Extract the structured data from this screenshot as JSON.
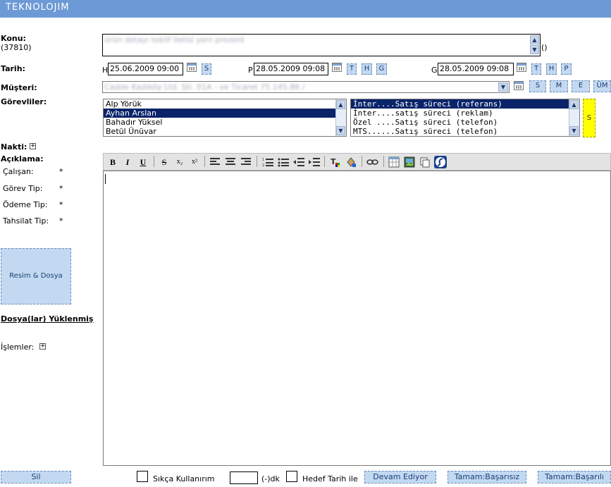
{
  "header": {
    "brand": "TEKNOLOJIM"
  },
  "form": {
    "konu_label": "Konu:",
    "konu_id": "(37810)",
    "konu_value": "ürün detayı teklif iletisi yeni prezent",
    "konu_suffix": "()",
    "tarih_label": "Tarih:",
    "h_prefix": "H",
    "h_date": "25.06.2009 09:00",
    "h_buttons": [
      "S"
    ],
    "p_prefix": "P",
    "p_date": "28.05.2009 09:08",
    "p_buttons": [
      "T",
      "H",
      "G"
    ],
    "g_prefix": "G",
    "g_date": "28.05.2009 09:08",
    "g_buttons": [
      "T",
      "H",
      "P"
    ],
    "musteri_label": "Müşteri:",
    "musteri_value": "Cadde Kadıköy Ltd. Şti. 01A - ve Ticaret 75.145.86 /",
    "musteri_buttons": [
      "S",
      "M",
      "E",
      "ÜM"
    ],
    "gorevliler_label": "Görevliler:",
    "people": [
      "Alp Yörük",
      "Ayhan Arslan",
      "Bahadır Yüksel",
      "Betül Ünüvar"
    ],
    "tasks": [
      "İnter....Satış süreci (referans)",
      "İnter....satış süreci (reklam)",
      "Özel ....Satış süreci (telefon)",
      "MTS......Satış süreci (telefon)"
    ],
    "tasks_button": "S",
    "nakti_label": "Nakti:",
    "aciklama_label": "Açıklama:",
    "calisan_label": "Çalışan:",
    "gorev_tip_label": "Görev Tip:",
    "odeme_tip_label": "Ödeme Tip:",
    "tahsilat_tip_label": "Tahsilat Tip:",
    "required_mark": "*",
    "resim_dosya_button": "Resim & Dosya",
    "dosya_yuklenmis": "Dosya(lar) Yüklenmiş",
    "islemler_label": "İşlemler:"
  },
  "editor_toolbar": {
    "bold": "B",
    "italic": "I",
    "underline": "U",
    "strike": "S",
    "subscript": "x₂",
    "superscript": "x²"
  },
  "footer": {
    "sil_button": "Sil",
    "sikca_label": "Sıkça Kullanırım",
    "dk_label": "(-)dk",
    "hedef_label": "Hedef Tarih ile",
    "devam_button": "Devam Ediyor",
    "basarisiz_button": "Tamam:Başarısız",
    "basarili_button": "Tamam:Başarılı"
  },
  "colors": {
    "header_bg": "#6d9ad6",
    "button_bg": "#c3d9f2",
    "selection": "#0a246a",
    "highlight": "#ffff00"
  }
}
